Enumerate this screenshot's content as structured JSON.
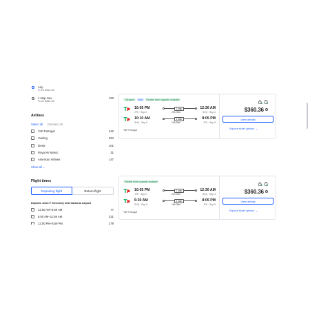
{
  "sidebar": {
    "stops": [
      {
        "label": "Any",
        "sub": "From $360.36",
        "count": "",
        "selected": true
      },
      {
        "label": "1 stop max",
        "sub": "From $360.36",
        "count": "193",
        "selected": false
      }
    ],
    "airlines": {
      "title": "Airlines",
      "select_all": "Select all",
      "deselect_all": "Deselect all",
      "items": [
        {
          "label": "TAP Portugal",
          "count": "242"
        },
        {
          "label": "Vueling",
          "count": "394"
        },
        {
          "label": "Iberia",
          "count": "101"
        },
        {
          "label": "Royal Air Maroc",
          "count": "31"
        },
        {
          "label": "American Airlines",
          "count": "147"
        }
      ],
      "show_all": "Show all"
    },
    "flight_times": {
      "title": "Flight times",
      "tab_departing": "Departing flight",
      "tab_return": "Return flight",
      "departs_label": "Departs John F. Kennedy International Airport",
      "items": [
        {
          "label": "12:00 AM–5:59 AM",
          "count": "77"
        },
        {
          "label": "6:00 AM–11:59 AM",
          "count": "221"
        },
        {
          "label": "12:00 PM–5:59 PM",
          "count": "279"
        }
      ]
    }
  },
  "results": [
    {
      "badges": [
        "Cheapest",
        "Best",
        "Flexible ticket upgrade available"
      ],
      "legs": [
        {
          "dep_time": "10:05 PM",
          "dep_sub": "JFK · Sep 2",
          "stops": "1 stop",
          "duration": "20h 25m",
          "arr_time": "12:30 AM",
          "arr_sub": "SVQ · Sep 4"
        },
        {
          "dep_time": "10:10 AM",
          "dep_sub": "SVQ · Sep 9",
          "stops": "1 stop",
          "duration": "15h 55m",
          "arr_time": "8:05 PM",
          "arr_sub": "JFK · Sep 9"
        }
      ],
      "airline": "TAP Portugal",
      "price": "$360.36",
      "view_details": "View details",
      "explore": "Explore ticket options"
    },
    {
      "badges": [
        "Flexible ticket upgrade available"
      ],
      "legs": [
        {
          "dep_time": "10:05 PM",
          "dep_sub": "JFK · Sep 2",
          "stops": "1 stop",
          "duration": "20h 25m",
          "arr_time": "12:30 AM",
          "arr_sub": "SVQ · Sep 4"
        },
        {
          "dep_time": "6:30 AM",
          "dep_sub": "SVQ · Sep 9",
          "stops": "1 stop",
          "duration": "18h 35m",
          "arr_time": "8:05 PM",
          "arr_sub": "JFK · Sep 9"
        }
      ],
      "airline": "TAP Portugal",
      "price": "$360.36",
      "view_details": "View details",
      "explore": "Explore ticket options"
    }
  ],
  "icons": {
    "tap_logo_green": "#2bb673",
    "tap_logo_red": "#e52521",
    "accent": "#1a5cff",
    "amenity_color": "#2e8b57"
  }
}
